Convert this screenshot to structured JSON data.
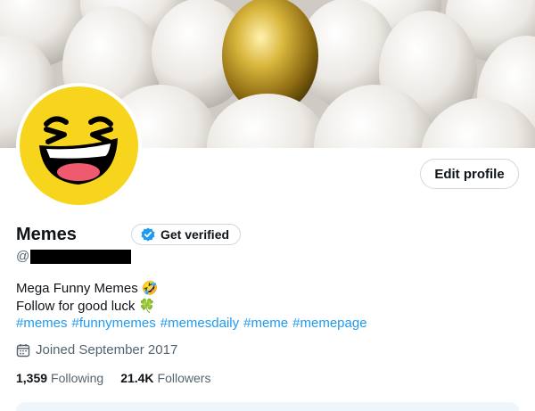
{
  "profile": {
    "display_name": "Memes",
    "verify_label": "Get verified",
    "handle_prefix": "@",
    "edit_label": "Edit profile",
    "bio_line1": "Mega Funny Memes 🤣",
    "bio_line2": "Follow for good luck 🍀",
    "hashtags": [
      "#memes",
      "#funnymemes",
      "#memesdaily",
      "#meme",
      "#memepage"
    ],
    "joined": "Joined September 2017",
    "following_count": "1,359",
    "following_label": "Following",
    "followers_count": "21.4K",
    "followers_label": "Followers"
  },
  "colors": {
    "accent": "#1d9bf0",
    "muted_text": "#536471",
    "avatar_yellow": "#f7d51c"
  },
  "icons": {
    "verified": "verified-badge-icon",
    "calendar": "calendar-icon"
  }
}
